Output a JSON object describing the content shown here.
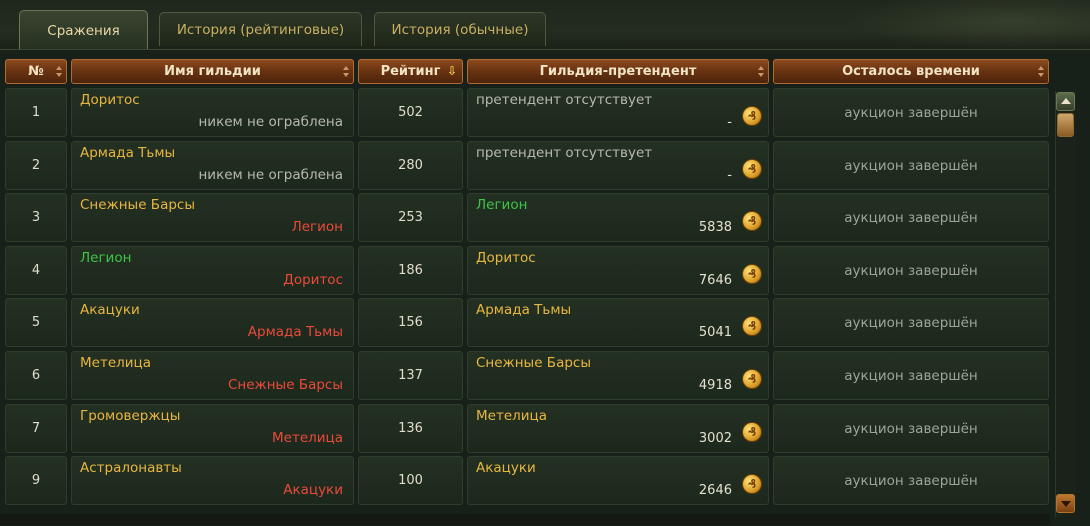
{
  "tabs": [
    {
      "label": "Сражения",
      "active": true
    },
    {
      "label": "История (рейтинговые)",
      "active": false
    },
    {
      "label": "История (обычные)",
      "active": false
    }
  ],
  "columns": {
    "num": "№",
    "guild": "Имя гильдии",
    "rating": "Рейтинг",
    "challenger": "Гильдия-претендент",
    "time_left": "Осталось времени"
  },
  "sort": {
    "column": "rating",
    "direction": "desc",
    "icon": "arrow-down-icon"
  },
  "colors": {
    "accent_gold": "#e8b640",
    "enemy_red": "#e94a3a",
    "ally_green": "#3ec44a",
    "header_brown": "#7a3d16"
  },
  "coin_glyph": "₰",
  "rows": [
    {
      "num": "1",
      "guild": "Доритос",
      "guild_color": "gold",
      "robbed_by": "никем не ограблена",
      "robbed_color": "gray",
      "rating": "502",
      "challenger": "претендент отсутствует",
      "challenger_color": "gray",
      "bid": "-",
      "time_left": "аукцион завершён"
    },
    {
      "num": "2",
      "guild": "Армада Тьмы",
      "guild_color": "gold",
      "robbed_by": "никем не ограблена",
      "robbed_color": "gray",
      "rating": "280",
      "challenger": "претендент отсутствует",
      "challenger_color": "gray",
      "bid": "-",
      "time_left": "аукцион завершён"
    },
    {
      "num": "3",
      "guild": "Снежные Барсы",
      "guild_color": "gold",
      "robbed_by": "Легион",
      "robbed_color": "red",
      "rating": "253",
      "challenger": "Легион",
      "challenger_color": "green",
      "bid": "5838",
      "time_left": "аукцион завершён"
    },
    {
      "num": "4",
      "guild": "Легион",
      "guild_color": "green",
      "robbed_by": "Доритос",
      "robbed_color": "red",
      "rating": "186",
      "challenger": "Доритос",
      "challenger_color": "gold",
      "bid": "7646",
      "time_left": "аукцион завершён"
    },
    {
      "num": "5",
      "guild": "Акацуки",
      "guild_color": "gold",
      "robbed_by": "Армада Тьмы",
      "robbed_color": "red",
      "rating": "156",
      "challenger": "Армада Тьмы",
      "challenger_color": "gold",
      "bid": "5041",
      "time_left": "аукцион завершён"
    },
    {
      "num": "6",
      "guild": "Метелица",
      "guild_color": "gold",
      "robbed_by": "Снежные Барсы",
      "robbed_color": "red",
      "rating": "137",
      "challenger": "Снежные Барсы",
      "challenger_color": "gold",
      "bid": "4918",
      "time_left": "аукцион завершён"
    },
    {
      "num": "7",
      "guild": "Громовержцы",
      "guild_color": "gold",
      "robbed_by": "Метелица",
      "robbed_color": "red",
      "rating": "136",
      "challenger": "Метелица",
      "challenger_color": "gold",
      "bid": "3002",
      "time_left": "аукцион завершён"
    },
    {
      "num": "9",
      "guild": "Астралонавты",
      "guild_color": "gold",
      "robbed_by": "Акацуки",
      "robbed_color": "red",
      "rating": "100",
      "challenger": "Акацуки",
      "challenger_color": "gold",
      "bid": "2646",
      "time_left": "аукцион завершён"
    }
  ]
}
